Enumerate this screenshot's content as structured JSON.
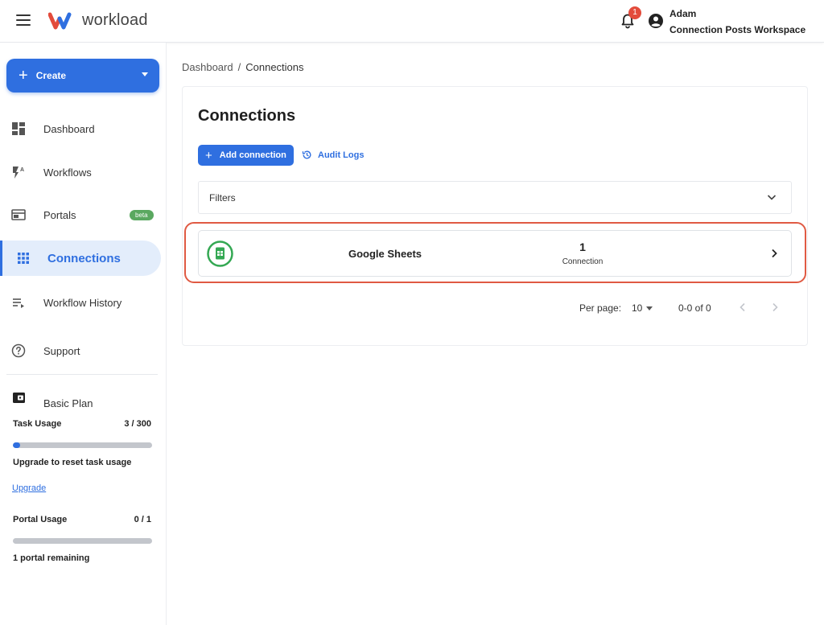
{
  "topbar": {
    "logo_text": "workload",
    "notification_count": "1",
    "user_name": "Adam",
    "workspace_name": "Connection Posts Workspace"
  },
  "sidebar": {
    "create_label": "Create",
    "items": [
      {
        "label": "Dashboard",
        "icon": "dashboard-icon"
      },
      {
        "label": "Workflows",
        "icon": "workflows-icon"
      },
      {
        "label": "Portals",
        "icon": "portals-icon",
        "badge": "beta"
      },
      {
        "label": "Connections",
        "icon": "connections-icon",
        "active": true
      },
      {
        "label": "Workflow History",
        "icon": "history-list-icon"
      },
      {
        "label": "Support",
        "icon": "help-icon"
      }
    ],
    "plan": {
      "label": "Basic Plan",
      "task_usage_label": "Task Usage",
      "task_usage_count": "3 / 300",
      "task_usage_fraction": 0.01,
      "upgrade_note": "Upgrade to reset task usage",
      "upgrade_link": "Upgrade",
      "portal_usage_label": "Portal Usage",
      "portal_usage_count": "0 / 1",
      "portal_usage_fraction": 0,
      "portal_remaining": "1 portal remaining"
    }
  },
  "breadcrumb": {
    "root": "Dashboard",
    "separator": "/",
    "current": "Connections"
  },
  "main": {
    "title": "Connections",
    "add_button": "Add connection",
    "audit_link": "Audit Logs",
    "filters_label": "Filters",
    "connections": [
      {
        "name": "Google Sheets",
        "count": "1",
        "unit": "Connection",
        "icon": "google-sheets-icon"
      }
    ],
    "pagination": {
      "per_page_label": "Per page:",
      "per_page_value": "10",
      "range": "0-0 of 0"
    }
  },
  "colors": {
    "accent": "#2f6fe0",
    "highlight": "#e05a43",
    "badge_green": "#5aa860",
    "notif_red": "#e34b3b"
  }
}
